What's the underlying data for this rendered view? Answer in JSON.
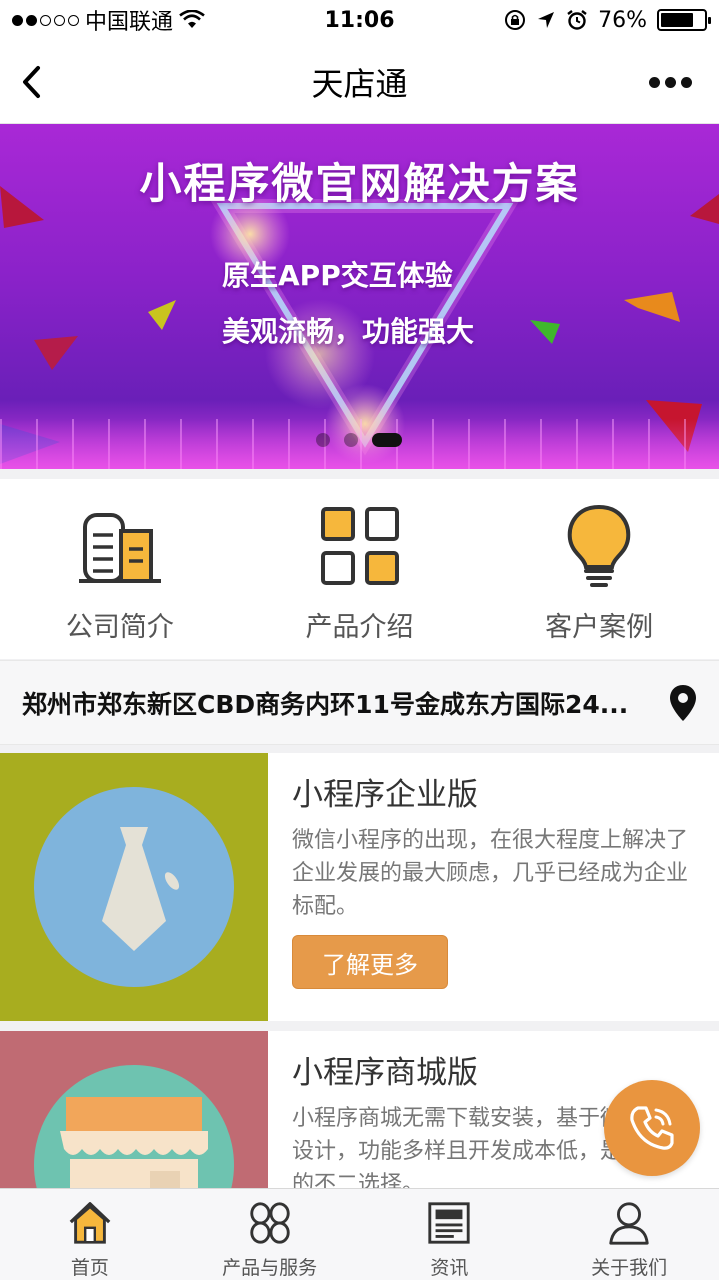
{
  "status_bar": {
    "carrier": "中国联通",
    "time": "11:06",
    "battery": "76%",
    "battery_level": 0.76
  },
  "nav": {
    "title": "天店通"
  },
  "banner": {
    "title": "小程序微官网解决方案",
    "line1": "原生APP交互体验",
    "line2": "美观流畅，功能强大",
    "slide_count": 3,
    "active_slide": 3
  },
  "quick": [
    {
      "label": "公司简介",
      "icon": "building-icon"
    },
    {
      "label": "产品介绍",
      "icon": "grid-icon"
    },
    {
      "label": "客户案例",
      "icon": "lightbulb-icon"
    }
  ],
  "address": {
    "text": "郑州市郑东新区CBD商务内环11号金成东方国际24..."
  },
  "cards": [
    {
      "title": "小程序企业版",
      "desc": "微信小程序的出现，在很大程度上解决了企业发展的最大顾虑，几乎已经成为企业标配。",
      "button": "了解更多",
      "icon": "tie-icon",
      "bg": "#a8ad1f",
      "circle": "#7fb4dc"
    },
    {
      "title": "小程序商城版",
      "desc": "小程序商城无需下载安装，基于微信平台设计，功能多样且开发成本低，是做生意的不二选择。",
      "icon": "shop-icon",
      "bg": "#c06b73",
      "circle": "#6ec3b0"
    }
  ],
  "tabs": [
    {
      "label": "首页",
      "icon": "home-icon",
      "active": true
    },
    {
      "label": "产品与服务",
      "icon": "services-icon"
    },
    {
      "label": "资讯",
      "icon": "news-icon"
    },
    {
      "label": "关于我们",
      "icon": "user-icon"
    }
  ],
  "colors": {
    "accent": "#e9953f",
    "icon_yellow": "#f6b73c"
  }
}
